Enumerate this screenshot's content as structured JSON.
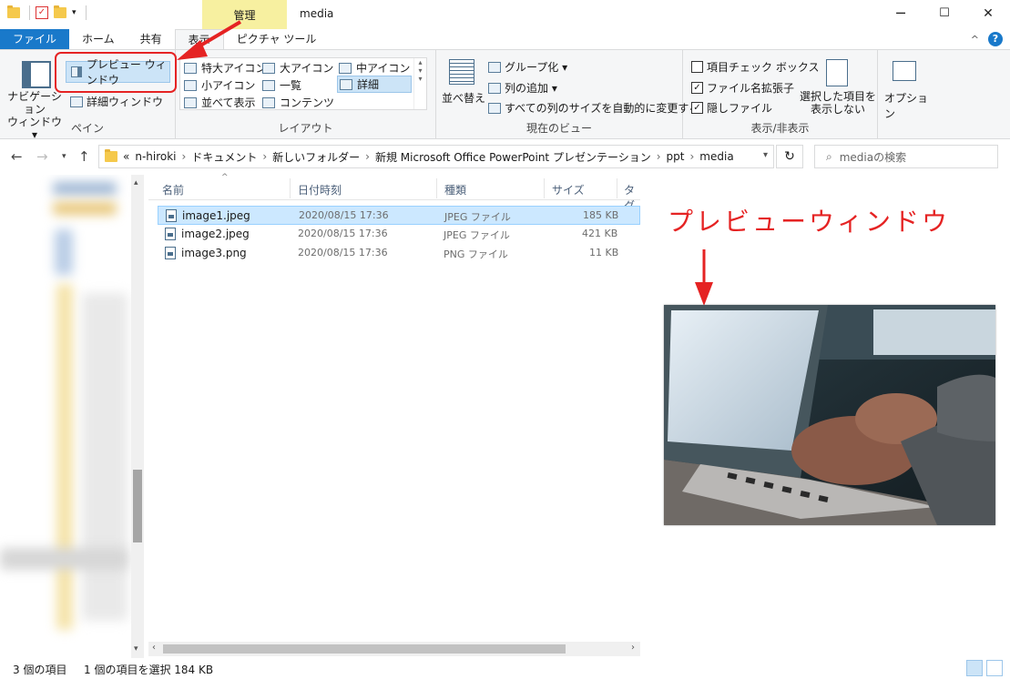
{
  "window": {
    "title": "media",
    "context_tab": "管理",
    "controls": {
      "minimize": "─",
      "maximize": "☐",
      "close": "✕"
    }
  },
  "ribbon_tabs": [
    {
      "label": "ファイル"
    },
    {
      "label": "ホーム"
    },
    {
      "label": "共有"
    },
    {
      "label": "表示"
    },
    {
      "label": "ピクチャ ツール"
    }
  ],
  "ribbon": {
    "pane": {
      "label": "ペイン",
      "nav_pane": "ナビゲーション\nウィンドウ ▾",
      "preview_pane": "プレビュー ウィンドウ",
      "details_pane": "詳細ウィンドウ"
    },
    "layout": {
      "label": "レイアウト",
      "items": [
        "特大アイコン",
        "大アイコン",
        "中アイコン",
        "小アイコン",
        "一覧",
        "詳細",
        "並べて表示",
        "コンテンツ"
      ]
    },
    "current_view": {
      "label": "現在のビュー",
      "sort": "並べ替え",
      "group_by": "グループ化 ▾",
      "add_columns": "列の追加 ▾",
      "fit_columns": "すべての列のサイズを自動的に変更する"
    },
    "show_hide": {
      "label": "表示/非表示",
      "item_checkboxes": {
        "label": "項目チェック ボックス",
        "checked": false
      },
      "file_extensions": {
        "label": "ファイル名拡張子",
        "checked": true
      },
      "hidden_items": {
        "label": "隠しファイル",
        "checked": true
      },
      "hide_selected": "選択した項目を\n表示しない"
    },
    "options": "オプション"
  },
  "address": {
    "overflow": "«",
    "crumbs": [
      "n-hiroki",
      "ドキュメント",
      "新しいフォルダー",
      "新規 Microsoft Office PowerPoint プレゼンテーション",
      "ppt",
      "media"
    ],
    "search_placeholder": "mediaの検索"
  },
  "columns": [
    "名前",
    "日付時刻",
    "種類",
    "サイズ",
    "タグ"
  ],
  "files": [
    {
      "name": "image1.jpeg",
      "date": "2020/08/15 17:36",
      "type": "JPEG ファイル",
      "size": "185 KB",
      "selected": true
    },
    {
      "name": "image2.jpeg",
      "date": "2020/08/15 17:36",
      "type": "JPEG ファイル",
      "size": "421 KB",
      "selected": false
    },
    {
      "name": "image3.png",
      "date": "2020/08/15 17:36",
      "type": "PNG ファイル",
      "size": "11 KB",
      "selected": false
    }
  ],
  "preview": {
    "annotation": "プレビューウィンドウ"
  },
  "status": {
    "count": "3 個の項目",
    "selection": "1 個の項目を選択 184 KB"
  },
  "colors": {
    "accent": "#1979ca",
    "selection": "#cce8ff",
    "annotation_red": "#e52323",
    "context_tab": "#f7f0a0"
  }
}
